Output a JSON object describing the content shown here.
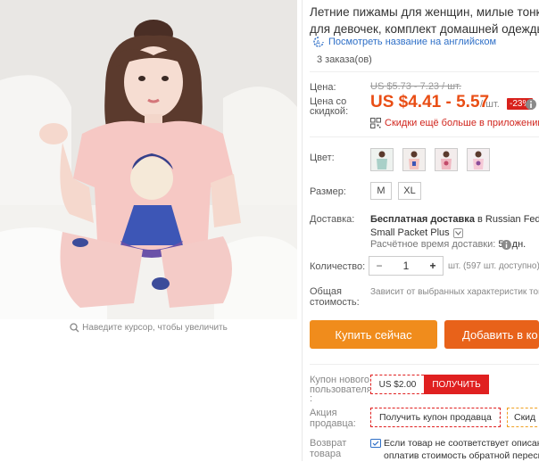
{
  "product": {
    "title_line1": "Летние пижамы для женщин, милые тонкие ж",
    "title_line2": "для девочек, комплект домашней одежды для",
    "translate_link": "Посмотреть название на английском",
    "orders": "3 заказа(ов)"
  },
  "image": {
    "zoom_hint": "Наведите курсор, чтобы увеличить"
  },
  "price": {
    "label": "Цена:",
    "old": "US $5.73 - 7.23 / шт.",
    "discount_label_1": "Цена со",
    "discount_label_2": "скидкой:",
    "new": "US $4.41 - 5.57",
    "unit": "/ шт.",
    "discount_badge": "-23%",
    "app_discount": "Скидки ещё больше в приложении"
  },
  "color": {
    "label": "Цвет:"
  },
  "size": {
    "label": "Размер:",
    "options": [
      "M",
      "XL"
    ]
  },
  "shipping": {
    "label": "Доставка:",
    "free": "Бесплатная доставка",
    "to": " в Russian Federati",
    "method": "Small Packet Plus",
    "eta_label": "Расчётное время доставки:",
    "eta_value": "52 дн."
  },
  "quantity": {
    "label": "Количество:",
    "minus": "−",
    "value": "1",
    "plus": "+",
    "note": "шт. (597 шт. доступно)"
  },
  "total": {
    "label_1": "Общая",
    "label_2": "стоимость:",
    "note": "Зависит от выбранных характеристик това"
  },
  "buttons": {
    "buy_now": "Купить сейчас",
    "add_to_cart": "Добавить в ко"
  },
  "new_user_coupon": {
    "label_1": "Купон нового",
    "label_2": "пользователя",
    "label_3": ":",
    "value": "US $2.00",
    "action": "ПОЛУЧИТЬ"
  },
  "seller_promo": {
    "label_1": "Акция",
    "label_2": "продавца:",
    "dropdown": "Получить купон продавца",
    "more": "Скид"
  },
  "guarantee": {
    "label_1": "Возврат",
    "label_2": "товара",
    "line1": "Если товар не соответствует описани",
    "line2": "оплатив стоимость обратной пересыл"
  },
  "colors": {
    "accent": "#e94e15",
    "buy_btn": "#f08c1c",
    "cart_btn": "#e8621a",
    "badge": "#d8211c",
    "link": "#2e6fc7"
  }
}
